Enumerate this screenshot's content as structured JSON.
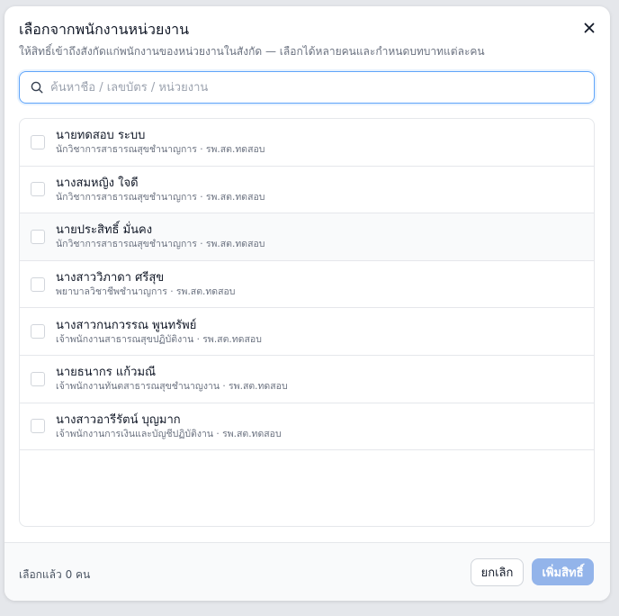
{
  "dialog": {
    "title": "เลือกจากพนักงานหน่วยงาน",
    "subtitle": "ให้สิทธิ์เข้าถึงสังกัดแก่พนักงานของหน่วยงานในสังกัด — เลือกได้หลายคนและกำหนดบทบาทแต่ละคน",
    "close_icon": "close-icon"
  },
  "search": {
    "placeholder": "ค้นหาชื่อ / เลขบัตร / หน่วยงาน",
    "value": "",
    "icon": "search-icon"
  },
  "employees": [
    {
      "name": "นายทดสอบ ระบบ",
      "detail": "นักวิชาการสาธารณสุขชำนาญการ · รพ.สต.ทดสอบ",
      "checked": false
    },
    {
      "name": "นางสมหญิง ใจดี",
      "detail": "นักวิชาการสาธารณสุขชำนาญการ · รพ.สต.ทดสอบ",
      "checked": false
    },
    {
      "name": "นายประสิทธิ์ มั่นคง",
      "detail": "นักวิชาการสาธารณสุขชำนาญการ · รพ.สต.ทดสอบ",
      "checked": false
    },
    {
      "name": "นางสาววิภาดา ศรีสุข",
      "detail": "พยาบาลวิชาชีพชำนาญการ · รพ.สต.ทดสอบ",
      "checked": false
    },
    {
      "name": "นางสาวกนกวรรณ พูนทรัพย์",
      "detail": "เจ้าพนักงานสาธารณสุขปฏิบัติงาน · รพ.สต.ทดสอบ",
      "checked": false
    },
    {
      "name": "นายธนากร แก้วมณี",
      "detail": "เจ้าพนักงานทันตสาธารณสุขชำนาญงาน · รพ.สต.ทดสอบ",
      "checked": false
    },
    {
      "name": "นางสาวอารีรัตน์ บุญมาก",
      "detail": "เจ้าพนักงานการเงินและบัญชีปฏิบัติงาน · รพ.สต.ทดสอบ",
      "checked": false
    }
  ],
  "footer": {
    "selected_text": "เลือกแล้ว 0 คน",
    "cancel_label": "ยกเลิก",
    "add_label": "เพิ่มสิทธิ์"
  },
  "colors": {
    "accent": "#93b4ea",
    "focus_border": "#60a5fa"
  }
}
